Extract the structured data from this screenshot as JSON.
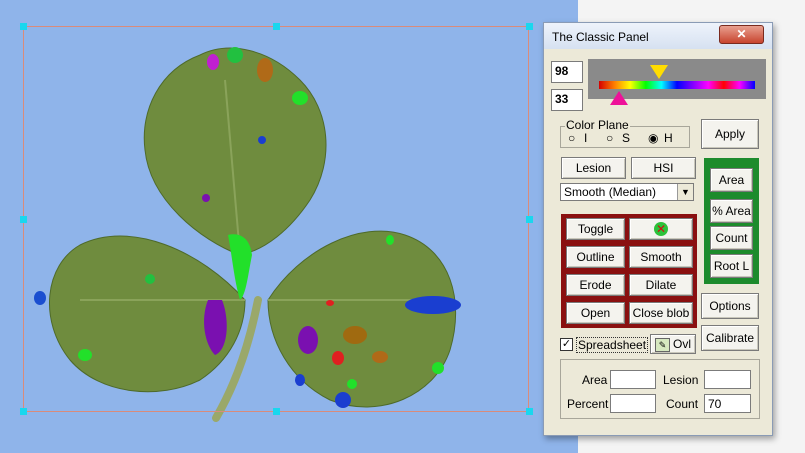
{
  "panel": {
    "title": "The Classic Panel",
    "close_label": "✕"
  },
  "hue_slider": {
    "upper_value": "98",
    "lower_value": "33",
    "upper_marker_color": "#ffdd00",
    "lower_marker_color": "#ee1199"
  },
  "color_plane": {
    "label": "Color Plane",
    "options": [
      "I",
      "S",
      "H"
    ],
    "selected": "H"
  },
  "buttons": {
    "apply": "Apply",
    "lesion": "Lesion",
    "hsi": "HSI",
    "toggle": "Toggle",
    "outline": "Outline",
    "smooth": "Smooth",
    "erode": "Erode",
    "dilate": "Dilate",
    "open": "Open",
    "close_blob": "Close blob",
    "area": "Area",
    "pct_area": "% Area",
    "count": "Count",
    "root_l": "Root L",
    "options": "Options",
    "calibrate": "Calibrate",
    "ovl": "Ovl"
  },
  "smooth_select": {
    "value": "Smooth (Median)"
  },
  "spreadsheet": {
    "label": "Spreadsheet",
    "checked": true
  },
  "measurements": {
    "area_label": "Area",
    "area_value": "",
    "lesion_label": "Lesion",
    "lesion_value": "",
    "percent_label": "Percent",
    "percent_value": "",
    "count_label": "Count",
    "count_value": "70"
  },
  "colors": {
    "canvas_bg": "#8fb4ea",
    "leaf": "#6f8c3e",
    "red_frame": "#8a1010",
    "green_frame": "#1d8b2c"
  }
}
